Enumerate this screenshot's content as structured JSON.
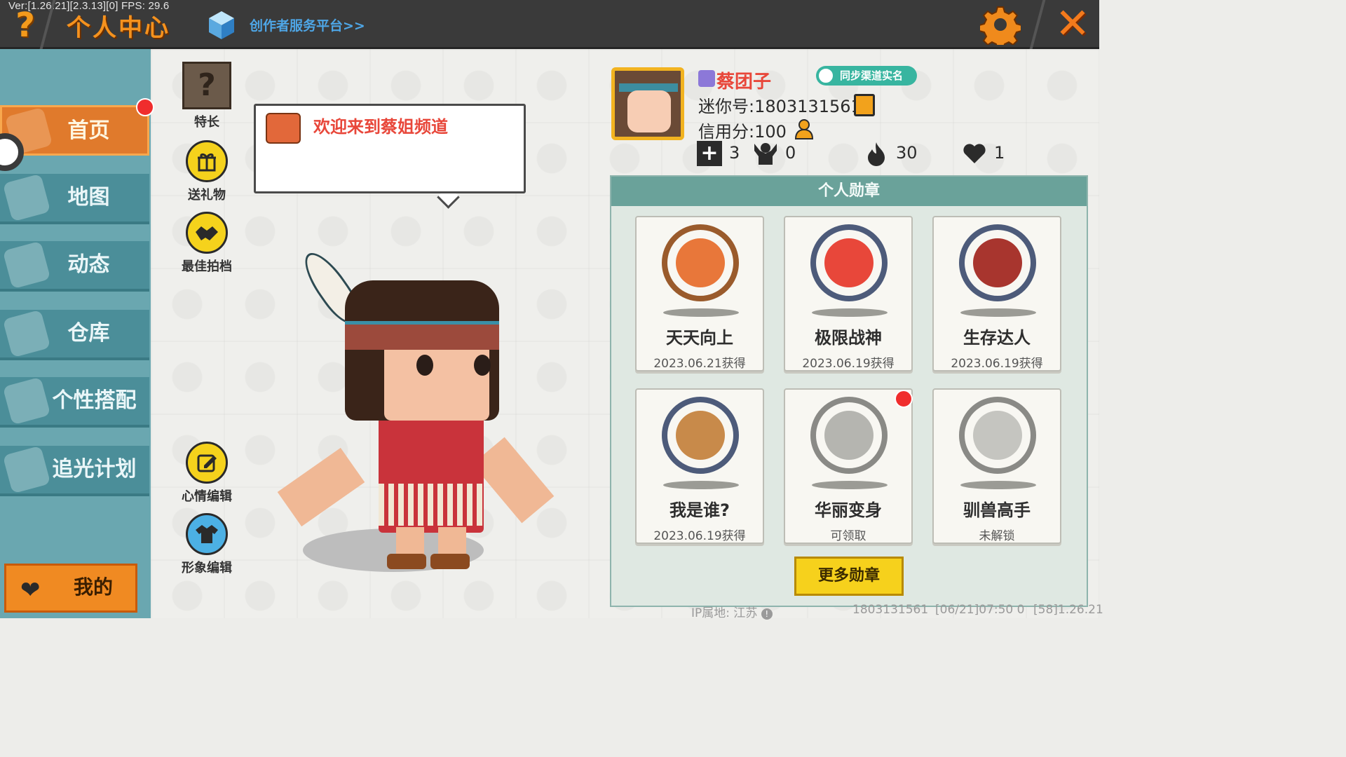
{
  "topbar": {
    "version": "Ver:[1.26.21][2.3.13][0] FPS: 29.6",
    "help_glyph": "?",
    "title": "个人中心",
    "creator_link": "创作者服务平台>>",
    "close_glyph": "✕"
  },
  "sidebar": {
    "items": [
      {
        "label": "首页",
        "active": true
      },
      {
        "label": "地图",
        "active": false
      },
      {
        "label": "动态",
        "active": false
      },
      {
        "label": "仓库",
        "active": false
      },
      {
        "label": "个性搭配",
        "active": false
      },
      {
        "label": "追光计划",
        "active": false
      }
    ],
    "mine_label": "我的"
  },
  "tools": {
    "specialty_glyph": "?",
    "specialty": "特长",
    "gift": "送礼物",
    "partner": "最佳拍档",
    "mood_edit": "心情编辑",
    "image_edit": "形象编辑"
  },
  "bubble": {
    "text": "欢迎来到蔡姐频道"
  },
  "profile": {
    "nickname": "蔡团子",
    "sync_label": "同步渠道实名",
    "mini_id": "迷你号:1803131561",
    "credit": "信用分:100",
    "stats": {
      "plus": "3",
      "fans": "0",
      "fire": "30",
      "likes": "1"
    },
    "plus_glyph": "+"
  },
  "medals": {
    "header": "个人勋章",
    "items": [
      {
        "name": "天天向上",
        "status": "2023.06.21获得",
        "color": "#e8773a"
      },
      {
        "name": "极限战神",
        "status": "2023.06.19获得",
        "color": "#e8473a"
      },
      {
        "name": "生存达人",
        "status": "2023.06.19获得",
        "color": "#a8352e"
      },
      {
        "name": "我是谁?",
        "status": "2023.06.19获得",
        "color": "#c88a4a"
      },
      {
        "name": "华丽变身",
        "status": "可领取",
        "color": "#b5b5b0"
      },
      {
        "name": "驯兽高手",
        "status": "未解锁",
        "color": "#c5c5c0"
      }
    ],
    "more_label": "更多勋章"
  },
  "footer": {
    "ip": "IP属地: 江苏",
    "info_glyph": "!",
    "id": "1803131561",
    "time": "[06/21]07:50 0",
    "build": "[58]1.26.21"
  },
  "colors": {
    "accent_orange": "#e07a2c",
    "sidebar_teal": "#4b8e99",
    "medal_header": "#6aa29a",
    "button_yellow": "#f6d11c"
  }
}
